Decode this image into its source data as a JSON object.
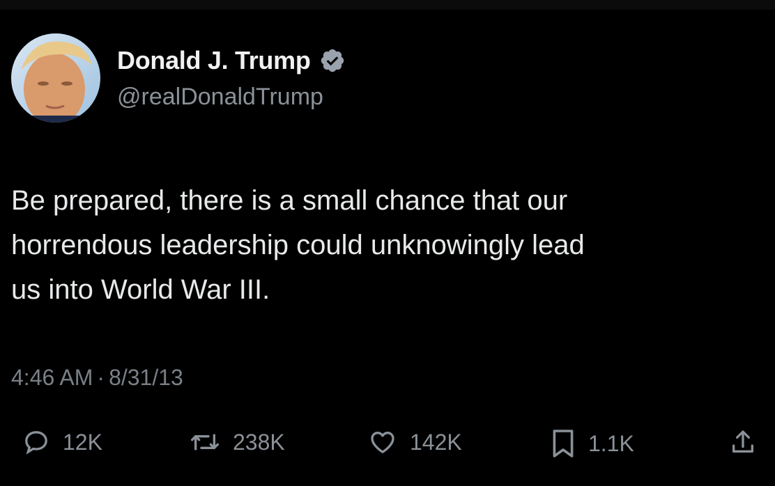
{
  "user": {
    "display_name": "Donald J. Trump",
    "handle": "@realDonaldTrump",
    "verified_badge_icon": "verified-check-icon"
  },
  "tweet": {
    "lines": [
      "Be prepared, there is a small chance that our",
      "horrendous leadership could unknowingly lead",
      "us into World War III."
    ]
  },
  "meta": {
    "time": "4:46 AM",
    "separator": "·",
    "date": "8/31/13"
  },
  "actions": {
    "reply": {
      "icon": "reply-icon",
      "count": "12K"
    },
    "retweet": {
      "icon": "retweet-icon",
      "count": "238K"
    },
    "like": {
      "icon": "heart-icon",
      "count": "142K"
    },
    "bookmark": {
      "icon": "bookmark-icon",
      "count": "1.1K"
    },
    "share": {
      "icon": "share-icon"
    }
  },
  "colors": {
    "background": "#000000",
    "text": "#e7e9ea",
    "secondary_text": "#8b9198",
    "verified_badge": "#9aa3ad"
  }
}
